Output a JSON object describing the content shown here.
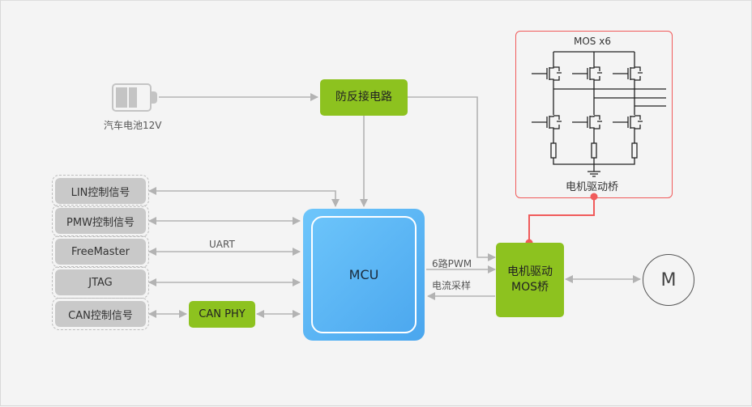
{
  "battery": {
    "icon": "battery-icon",
    "label": "汽车电池12V"
  },
  "reverse_protection": {
    "label": "防反接电路"
  },
  "mcu": {
    "label": "MCU"
  },
  "interfaces": [
    {
      "label": "LIN控制信号"
    },
    {
      "label": "PMW控制信号"
    },
    {
      "label": "FreeMaster"
    },
    {
      "label": "JTAG"
    },
    {
      "label": "CAN控制信号"
    }
  ],
  "uart_label": "UART",
  "can_phy": {
    "label": "CAN PHY"
  },
  "pwm_label": "6路PWM",
  "current_label": "电流采样",
  "driver": {
    "line1": "电机驱动",
    "line2": "MOS桥"
  },
  "mos_bridge": {
    "title": "MOS x6",
    "caption": "电机驱动桥"
  },
  "motor": {
    "label": "M"
  },
  "colors": {
    "green": "#8dc21f",
    "blue": "#55b2f4",
    "red": "#f05a5a",
    "wire": "#b3b3b3"
  }
}
